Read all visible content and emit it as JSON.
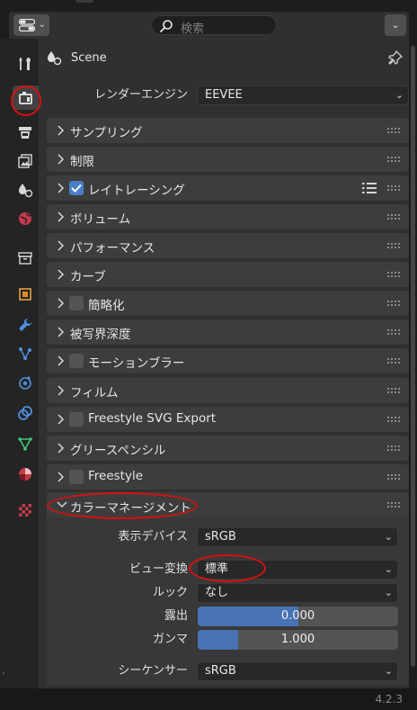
{
  "header": {
    "search_placeholder": "検索"
  },
  "tabs": [
    {
      "name": "tool-tab-icon",
      "active": false
    },
    {
      "name": "render-tab-icon",
      "active": true
    },
    {
      "name": "output-tab-icon",
      "active": false
    },
    {
      "name": "view-layer-tab-icon",
      "active": false
    },
    {
      "name": "scene-tab-icon",
      "active": false
    },
    {
      "name": "world-tab-icon",
      "active": false
    },
    {
      "name": "collection-tab-icon",
      "active": false
    },
    {
      "name": "object-tab-icon",
      "active": false
    },
    {
      "name": "modifier-tab-icon",
      "active": false
    },
    {
      "name": "particles-tab-icon",
      "active": false
    },
    {
      "name": "physics-tab-icon",
      "active": false
    },
    {
      "name": "constraints-tab-icon",
      "active": false
    },
    {
      "name": "data-tab-icon",
      "active": false
    },
    {
      "name": "material-tab-icon",
      "active": false
    },
    {
      "name": "texture-tab-icon",
      "active": false
    }
  ],
  "context": {
    "scene_label": "Scene"
  },
  "render_engine": {
    "label": "レンダーエンジン",
    "value": "EEVEE"
  },
  "panels": [
    {
      "title": "サンプリング"
    },
    {
      "title": "制限"
    },
    {
      "title": "レイトレーシング"
    },
    {
      "title": "ボリューム"
    },
    {
      "title": "パフォーマンス"
    },
    {
      "title": "カーブ"
    },
    {
      "title": "簡略化"
    },
    {
      "title": "被写界深度"
    },
    {
      "title": "モーションブラー"
    },
    {
      "title": "フィルム"
    },
    {
      "title": "Freestyle SVG Export"
    },
    {
      "title": "グリースペンシル"
    },
    {
      "title": "Freestyle"
    },
    {
      "title": "カラーマネージメント"
    }
  ],
  "checkboxes": {
    "raytracing": true,
    "simplify": false,
    "motion_blur": false,
    "freestyle_svg": false,
    "freestyle": false
  },
  "color_management": {
    "display_device": {
      "label": "表示デバイス",
      "value": "sRGB"
    },
    "view_transform": {
      "label": "ビュー変換",
      "value": "標準"
    },
    "look": {
      "label": "ルック",
      "value": "なし"
    },
    "exposure": {
      "label": "露出",
      "value": "0.000",
      "fill": 0.5
    },
    "gamma": {
      "label": "ガンマ",
      "value": "1.000",
      "fill": 0.2
    },
    "sequencer": {
      "label": "シーケンサー",
      "value": "sRGB"
    }
  },
  "footer": {
    "version": "4.2.3"
  },
  "colors": {
    "annotation": "#d81010",
    "accent_blue": "#4772b3",
    "checkbox_on": "#4a7fc6"
  }
}
